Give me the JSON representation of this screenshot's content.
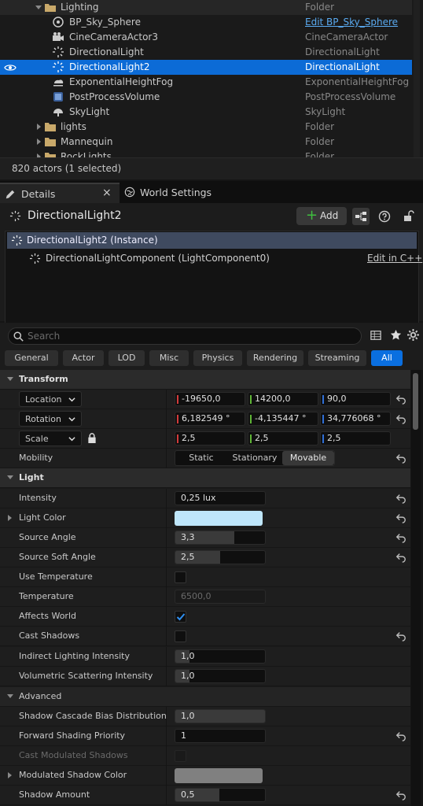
{
  "outliner": {
    "rows": [
      {
        "name": "Lighting",
        "type": "Folder"
      },
      {
        "name": "BP_Sky_Sphere",
        "type": "Edit BP_Sky_Sphere"
      },
      {
        "name": "CineCameraActor3",
        "type": "CineCameraActor"
      },
      {
        "name": "DirectionalLight",
        "type": "DirectionalLight"
      },
      {
        "name": "DirectionalLight2",
        "type": "DirectionalLight"
      },
      {
        "name": "ExponentialHeightFog",
        "type": "ExponentialHeightFog"
      },
      {
        "name": "PostProcessVolume",
        "type": "PostProcessVolume"
      },
      {
        "name": "SkyLight",
        "type": "SkyLight"
      },
      {
        "name": "lights",
        "type": "Folder"
      },
      {
        "name": "Mannequin",
        "type": "Folder"
      },
      {
        "name": "RockLights",
        "type": "Folder"
      }
    ],
    "status": "820 actors (1 selected)"
  },
  "tabs": {
    "details": "Details",
    "world_settings": "World Settings",
    "close": "×"
  },
  "details": {
    "actor_name": "DirectionalLight2",
    "add_label": "Add",
    "instance_label": "DirectionalLight2 (Instance)",
    "component_label": "DirectionalLightComponent (LightComponent0)",
    "edit_cpp": "Edit in C++",
    "search_placeholder": "Search"
  },
  "filters": [
    "General",
    "Actor",
    "LOD",
    "Misc",
    "Physics",
    "Rendering",
    "Streaming",
    "All"
  ],
  "transform": {
    "header": "Transform",
    "location_label": "Location",
    "location": [
      "-19650,0",
      "14200,0",
      "90,0"
    ],
    "rotation_label": "Rotation",
    "rotation": [
      "6,182549 °",
      "-4,135447 °",
      "34,776068 °"
    ],
    "scale_label": "Scale",
    "scale": [
      "2,5",
      "2,5",
      "2,5"
    ],
    "mobility_label": "Mobility",
    "mobility_options": [
      "Static",
      "Stationary",
      "Movable"
    ],
    "mobility_selected": "Movable"
  },
  "light": {
    "header": "Light",
    "intensity_label": "Intensity",
    "intensity": "0,25 lux",
    "light_color_label": "Light Color",
    "light_color": "#bfe6fb",
    "source_angle_label": "Source Angle",
    "source_angle": "3,3",
    "source_angle_fill": 0.66,
    "source_soft_angle_label": "Source Soft Angle",
    "source_soft_angle": "2,5",
    "source_soft_angle_fill": 0.5,
    "use_temperature_label": "Use Temperature",
    "temperature_label": "Temperature",
    "temperature": "6500,0",
    "affects_world_label": "Affects World",
    "cast_shadows_label": "Cast Shadows",
    "indirect_label": "Indirect Lighting Intensity",
    "indirect": "1,0",
    "volumetric_label": "Volumetric Scattering Intensity",
    "volumetric": "1,0"
  },
  "advanced": {
    "header": "Advanced",
    "cascade_label": "Shadow Cascade Bias Distribution",
    "cascade": "1,0",
    "forward_label": "Forward Shading Priority",
    "forward": "1",
    "cast_modulated_label": "Cast Modulated Shadows",
    "modulated_color_label": "Modulated Shadow Color",
    "modulated_color": "#808080",
    "shadow_amount_label": "Shadow Amount",
    "shadow_amount": "0,5"
  },
  "colors": {
    "selection": "#0c6bd6",
    "axis_x": "#d23b3b",
    "axis_y": "#5fb536",
    "axis_z": "#2f6fd8",
    "filter_active": "#0a6fe0"
  }
}
